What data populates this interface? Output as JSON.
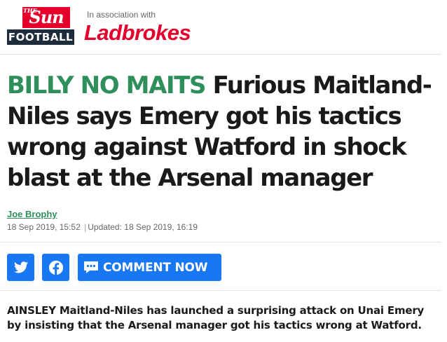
{
  "header": {
    "sun_logo": {
      "the": "THE",
      "sun": "Sun"
    },
    "football_label": "FOOTBALL",
    "association_text": "In association with",
    "sponsor_logo": "Ladbrokes"
  },
  "article": {
    "kicker": "BILLY NO MAITS",
    "headline": "Furious Maitland-Niles says Emery got his tactics wrong against Watford in shock blast at the Arsenal manager",
    "author": "Joe Brophy",
    "published": "18 Sep 2019, 15:52",
    "separator": "|",
    "updated": "Updated: 18 Sep 2019, 16:19",
    "lede": "AINSLEY Maitland-Niles has launched a surprising attack on Unai Emery by insisting that the Arsenal manager got his tactics wrong at Watford."
  },
  "share": {
    "twitter_icon": "twitter-icon",
    "facebook_icon": "facebook-icon",
    "comment_icon": "comment-icon",
    "comment_label": "COMMENT NOW"
  },
  "colors": {
    "sun_red": "#e4002b",
    "football_navy": "#1e2d3b",
    "kicker_green": "#2f8f5b",
    "share_blue": "#1877f2"
  }
}
